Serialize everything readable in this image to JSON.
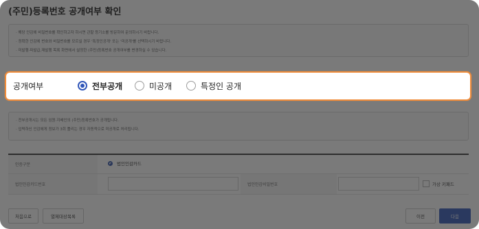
{
  "page": {
    "title": "(주민)등록번호 공개여부 확인"
  },
  "notice_top": {
    "lines": [
      "· 해당 인감에 비밀번호를 확인하고자 하시면 관할 등기소를 방문하여 문의하시기 바랍니다.",
      "· 정확한 인감에 번호와 비밀번호를 모르실 경우 '특정인공개' 또는 '미공개'를 선택하시기 바랍니다.",
      "· 미발행·파발급,재발행 목록 화면에서 설정한 (주민)등록번호 공개여부를 변경하실 수 있습니다."
    ]
  },
  "disclosure": {
    "label": "공개여부",
    "selected": "전부공개",
    "options": [
      {
        "label": "전부공개",
        "checked": true
      },
      {
        "label": "미공개",
        "checked": false
      },
      {
        "label": "특정인 공개",
        "checked": false
      }
    ]
  },
  "notice_bottom": {
    "lines": [
      "· 전부공개시는 모든 임원·지배인의 (주민)등록번호가 공개됩니다.",
      "· 입력하신 인감에게 정보가 3회 틀리는 경우 자동적으로 미공개로 처리됩니다."
    ]
  },
  "form": {
    "auth_type_label": "인증구분",
    "auth_type_value": "법인인감카드",
    "card_number_label": "법인인감카드번호",
    "card_password_label": "법인인감비밀번호",
    "virtual_keyboard_label": "가상 키패드"
  },
  "buttons": {
    "first": "처음으로",
    "target_list": "열제대상목록",
    "prev": "이전",
    "next": "다음"
  },
  "colors": {
    "highlight_border": "#f08c3a",
    "accent": "#2f55b8",
    "overlay": "rgba(40,40,40,0.62)"
  }
}
